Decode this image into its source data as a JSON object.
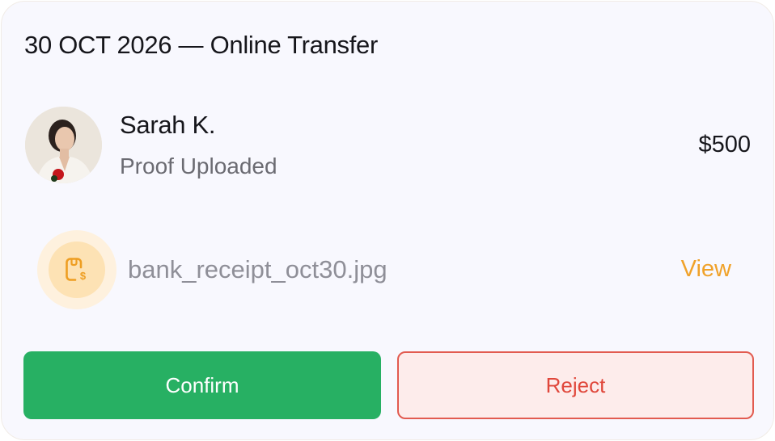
{
  "card": {
    "title": "30 OCT 2026 — Online Transfer"
  },
  "payer": {
    "name": "Sarah K.",
    "status": "Proof Uploaded",
    "amount": "$500",
    "avatar_icon": "user-avatar-photo"
  },
  "attachment": {
    "icon": "receipt-dollar-icon",
    "filename": "bank_receipt_oct30.jpg",
    "view_label": "View"
  },
  "actions": {
    "confirm_label": "Confirm",
    "reject_label": "Reject"
  },
  "colors": {
    "confirm": "#27b063",
    "reject": "#e0473b",
    "accent": "#f0a22a"
  }
}
